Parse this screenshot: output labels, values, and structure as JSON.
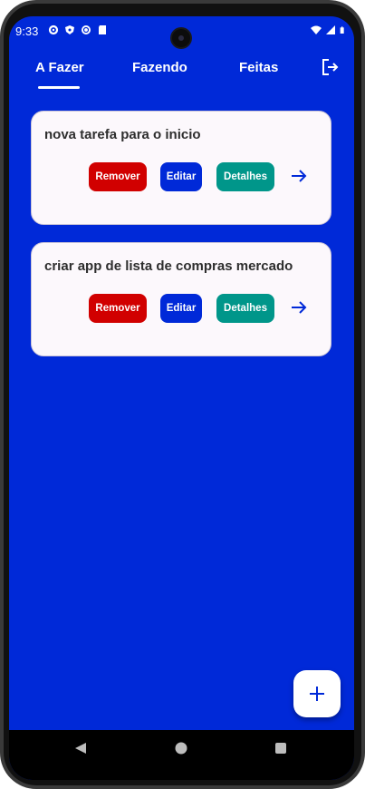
{
  "status_bar": {
    "time": "9:33",
    "left_icons": [
      "settings-icon",
      "shield-icon",
      "sync-icon",
      "sd-card-icon"
    ],
    "right_icons": [
      "wifi-icon",
      "signal-icon",
      "battery-icon"
    ]
  },
  "tabs": [
    {
      "label": "A Fazer",
      "active": true
    },
    {
      "label": "Fazendo",
      "active": false
    },
    {
      "label": "Feitas",
      "active": false
    }
  ],
  "toolbar": {
    "logout_icon": "logout-icon"
  },
  "tasks": [
    {
      "title": "nova tarefa para o inicio",
      "remove_label": "Remover",
      "edit_label": "Editar",
      "details_label": "Detalhes"
    },
    {
      "title": "criar app de lista de compras mercado",
      "remove_label": "Remover",
      "edit_label": "Editar",
      "details_label": "Detalhes"
    }
  ],
  "fab": {
    "icon": "add-icon"
  },
  "colors": {
    "background": "#0029D8",
    "remove": "#D10000",
    "edit": "#0029D8",
    "details": "#00968A",
    "card": "#FCF8FC"
  }
}
